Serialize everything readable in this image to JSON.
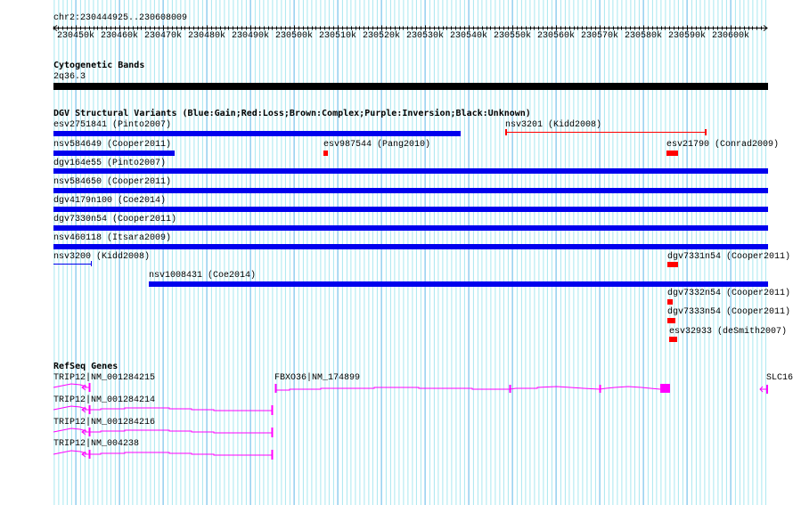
{
  "ruler": {
    "range": "chr2:230444925..230608009",
    "ticks": [
      "230450k",
      "230460k",
      "230470k",
      "230480k",
      "230490k",
      "230500k",
      "230510k",
      "230520k",
      "230530k",
      "230540k",
      "230550k",
      "230560k",
      "230570k",
      "230580k",
      "230590k",
      "230600k"
    ]
  },
  "cyto": {
    "title": "Cytogenetic Bands",
    "band": "2q36.3"
  },
  "dgv": {
    "title": "DGV Structural Variants (Blue:Gain;Red:Loss;Brown:Complex;Purple:Inversion;Black:Unknown)",
    "variants": [
      {
        "label": "esv2751841 (Pinto2007)",
        "color": "#0000ee"
      },
      {
        "label": "nsv3201 (Kidd2008)",
        "color": "#ff0000"
      },
      {
        "label": "nsv584649 (Cooper2011)",
        "color": "#0000ee"
      },
      {
        "label": "esv987544 (Pang2010)",
        "color": "#ff0000"
      },
      {
        "label": "esv21790 (Conrad2009)",
        "color": "#ff0000"
      },
      {
        "label": "dgv164e55 (Pinto2007)",
        "color": "#0000ee"
      },
      {
        "label": "nsv584650 (Cooper2011)",
        "color": "#0000ee"
      },
      {
        "label": "dgv4179n100 (Coe2014)",
        "color": "#0000ee"
      },
      {
        "label": "dgv7330n54 (Cooper2011)",
        "color": "#0000ee"
      },
      {
        "label": "nsv460118 (Itsara2009)",
        "color": "#0000ee"
      },
      {
        "label": "nsv3200 (Kidd2008)",
        "color": "#0000ee"
      },
      {
        "label": "dgv7331n54 (Cooper2011)",
        "color": "#ff0000"
      },
      {
        "label": "nsv1008431 (Coe2014)",
        "color": "#0000ee"
      },
      {
        "label": "dgv7332n54 (Cooper2011)",
        "color": "#ff0000"
      },
      {
        "label": "dgv7333n54 (Cooper2011)",
        "color": "#ff0000"
      },
      {
        "label": "esv32933 (deSmith2007)",
        "color": "#ff0000"
      }
    ]
  },
  "genes": {
    "title": "RefSeq Genes",
    "color": "#ff00ff",
    "items": [
      {
        "label": "TRIP12|NM_001284215"
      },
      {
        "label": "FBXO36|NM_174899"
      },
      {
        "label": "SLC16"
      },
      {
        "label": "TRIP12|NM_001284214"
      },
      {
        "label": "TRIP12|NM_001284216"
      },
      {
        "label": "TRIP12|NM_004238"
      }
    ]
  }
}
